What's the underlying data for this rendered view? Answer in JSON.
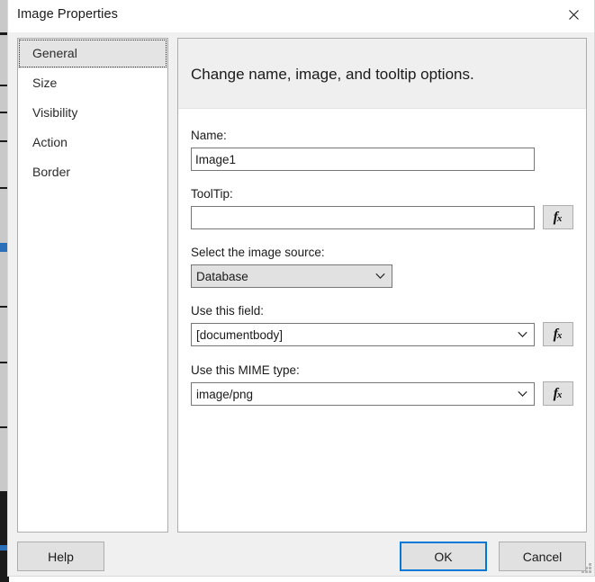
{
  "window": {
    "title": "Image Properties",
    "close_icon": "close-icon",
    "accent_color": "#0078d7"
  },
  "sidebar": {
    "items": [
      {
        "label": "General",
        "selected": true
      },
      {
        "label": "Size",
        "selected": false
      },
      {
        "label": "Visibility",
        "selected": false
      },
      {
        "label": "Action",
        "selected": false
      },
      {
        "label": "Border",
        "selected": false
      }
    ]
  },
  "panel": {
    "header": "Change name, image, and tooltip options.",
    "fields": {
      "name": {
        "label": "Name:",
        "value": "Image1",
        "placeholder": ""
      },
      "tooltip": {
        "label": "ToolTip:",
        "value": "",
        "placeholder": "",
        "expression_button": "fx"
      },
      "image_source": {
        "label": "Select the image source:",
        "value": "Database",
        "chevron_icon": "chevron-down-icon"
      },
      "field": {
        "label": "Use this field:",
        "value": "[documentbody]",
        "chevron_icon": "chevron-down-icon",
        "expression_button": "fx"
      },
      "mime_type": {
        "label": "Use this MIME type:",
        "value": "image/png",
        "chevron_icon": "chevron-down-icon",
        "expression_button": "fx"
      }
    }
  },
  "footer": {
    "help_label": "Help",
    "ok_label": "OK",
    "cancel_label": "Cancel"
  }
}
